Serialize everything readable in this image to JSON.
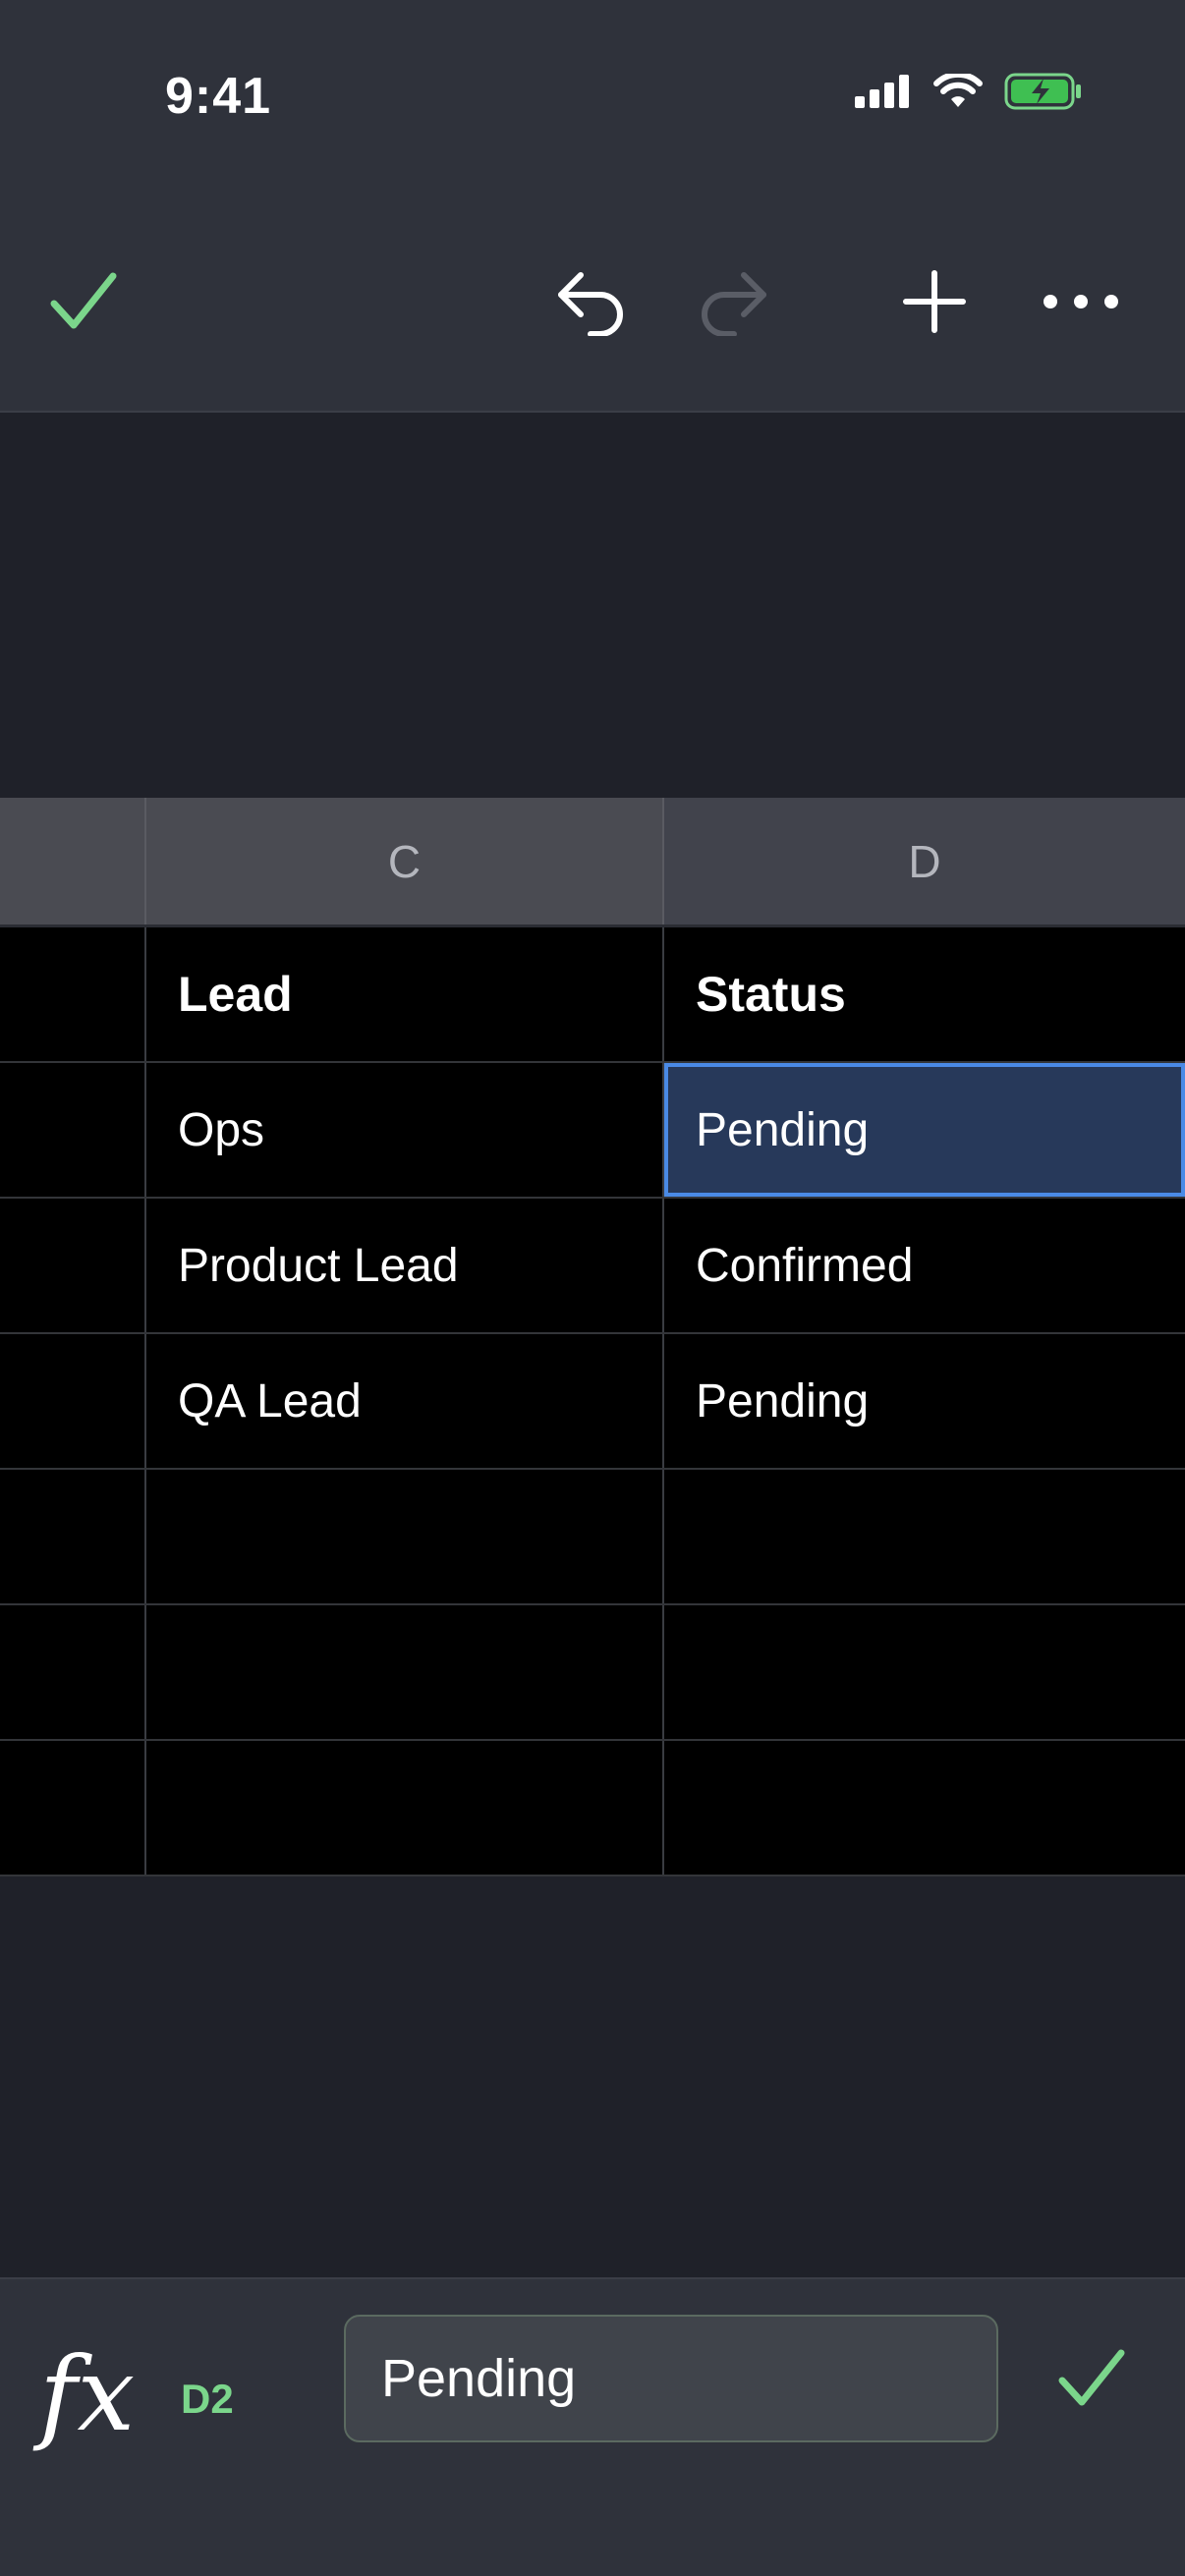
{
  "status_bar": {
    "time": "9:41"
  },
  "toolbar": {
    "icons": [
      "checkmark-icon",
      "undo-icon",
      "redo-icon",
      "plus-icon",
      "more-icon"
    ],
    "accent_color": "#7bd68b"
  },
  "sheet": {
    "column_headers": [
      "C",
      "D"
    ],
    "rows": [
      {
        "c": "Lead",
        "d": "Status"
      },
      {
        "c": "Ops",
        "d": "Pending"
      },
      {
        "c": "Product Lead",
        "d": "Confirmed"
      },
      {
        "c": "QA Lead",
        "d": "Pending"
      },
      {
        "c": "",
        "d": ""
      },
      {
        "c": "",
        "d": ""
      },
      {
        "c": "",
        "d": ""
      }
    ],
    "selected_color": "#4a8ae6"
  },
  "formula_bar": {
    "fx_label": "fx",
    "cell_reference": "D2",
    "value": "Pending"
  }
}
